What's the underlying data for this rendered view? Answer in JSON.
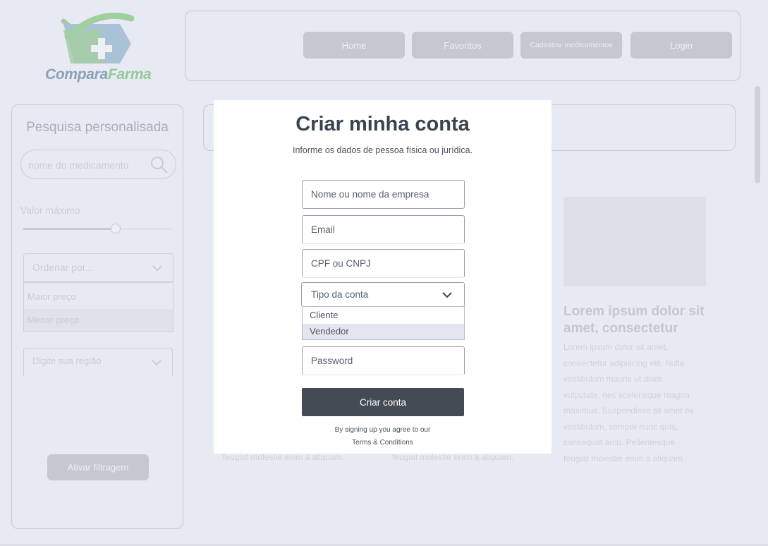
{
  "brand": {
    "part1": "Compara",
    "part2": "Farma"
  },
  "nav": {
    "home": "Home",
    "favoritos": "Favoritos",
    "cadastrar": "Cadastrar medicamentos",
    "login": "Login"
  },
  "sidebar": {
    "title": "Pesquisa personalisada",
    "search_placeholder": "nome do medicamento",
    "valor_label": "Valor máximo",
    "slider_value_fraction": 0.62,
    "ordenar_label": "Ordenar por...",
    "ordenar_options": [
      "Maior preço",
      "Menor preço"
    ],
    "regiao_placeholder": "Digite sua região",
    "ativar_label": "Ativar filtragem"
  },
  "card": {
    "title": "Lorem ipsum dolor sit amet, consectetur",
    "body_lines": [
      "Lorem ipsum dolor sit amet,",
      "consectetur adipiscing elit. Nulla",
      "vestibulum mauris ut diam",
      "vulputate, nec scelerisque magna",
      "maximus. Suspendisse sit amet ex",
      "vestibulum, semper nunc quis,",
      "consequat arcu. Pellentesque",
      "feugiat molestie enim a aliquam."
    ],
    "foot_left": "feugiat molestie enim a aliquam.",
    "foot_mid": "feugiat molestie enim a aliquam."
  },
  "modal": {
    "title": "Criar minha conta",
    "subtitle": "Informe os dados de pessoa física ou jurídica.",
    "name_placeholder": "Nome ou nome da empresa",
    "email_placeholder": "Email",
    "cpf_placeholder": "CPF ou CNPJ",
    "tipo_label": "Tipo da conta",
    "tipo_options": [
      "Cliente",
      "Vendedor"
    ],
    "password_placeholder": "Password",
    "submit_label": "Criar conta",
    "terms_line1": "By signing up you agree to our",
    "terms_line2": "Terms & Conditions"
  },
  "colors": {
    "overlay_bg": "#e8eaf3",
    "button_dark": "#444b54",
    "logo_green": "#96c996",
    "logo_blue": "#8aa0b8"
  }
}
